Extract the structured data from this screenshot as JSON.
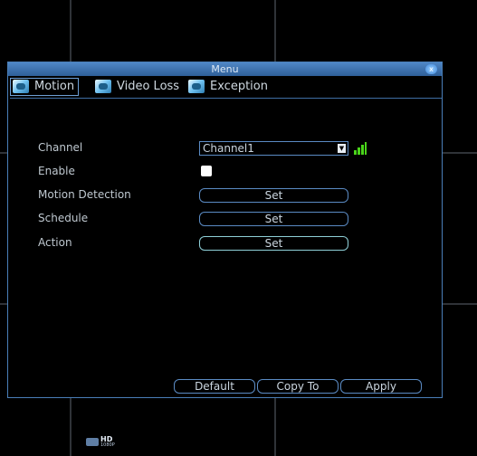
{
  "window": {
    "title": "Menu",
    "close_glyph": "x"
  },
  "tabs": [
    {
      "label": "Motion",
      "icon": "motion-tab-icon",
      "active": true
    },
    {
      "label": "Video Loss",
      "icon": "video-loss-tab-icon",
      "active": false
    },
    {
      "label": "Exception",
      "icon": "exception-tab-icon",
      "active": false
    }
  ],
  "form": {
    "channel_label": "Channel",
    "channel_value": "Channel1",
    "enable_label": "Enable",
    "enable_checked": false,
    "motion_detection_label": "Motion Detection",
    "motion_detection_button": "Set",
    "schedule_label": "Schedule",
    "schedule_button": "Set",
    "action_label": "Action",
    "action_button": "Set"
  },
  "footer": {
    "default_label": "Default",
    "copy_to_label": "Copy To",
    "apply_label": "Apply"
  },
  "overlay": {
    "hd_badge": "HD",
    "hd_resolution": "1080P"
  },
  "colors": {
    "accent": "#4f87c6",
    "signal": "#4ad41a"
  }
}
